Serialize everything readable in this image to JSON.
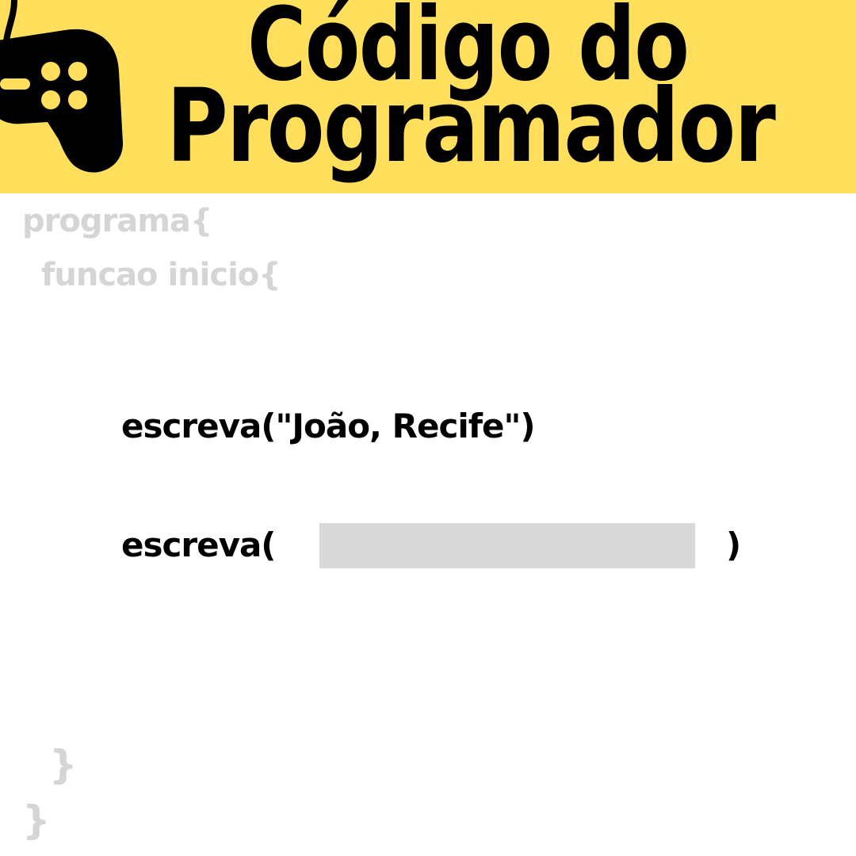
{
  "header": {
    "title_line_1": "Código do",
    "title_line_2": "Programador",
    "background_color": "#ffdf5c",
    "logo_icon": "gamepad-icon"
  },
  "code": {
    "programa_line": "programa{",
    "funcao_line": "funcao inicio{",
    "statement_1": "escreva(\"João, Recife\")",
    "statement_2_open": "escreva(",
    "statement_2_close": ")",
    "close_funcao": "}",
    "close_programa": "}",
    "faded_color": "#d5d5d5",
    "blank_color": "#d9d9d9"
  }
}
